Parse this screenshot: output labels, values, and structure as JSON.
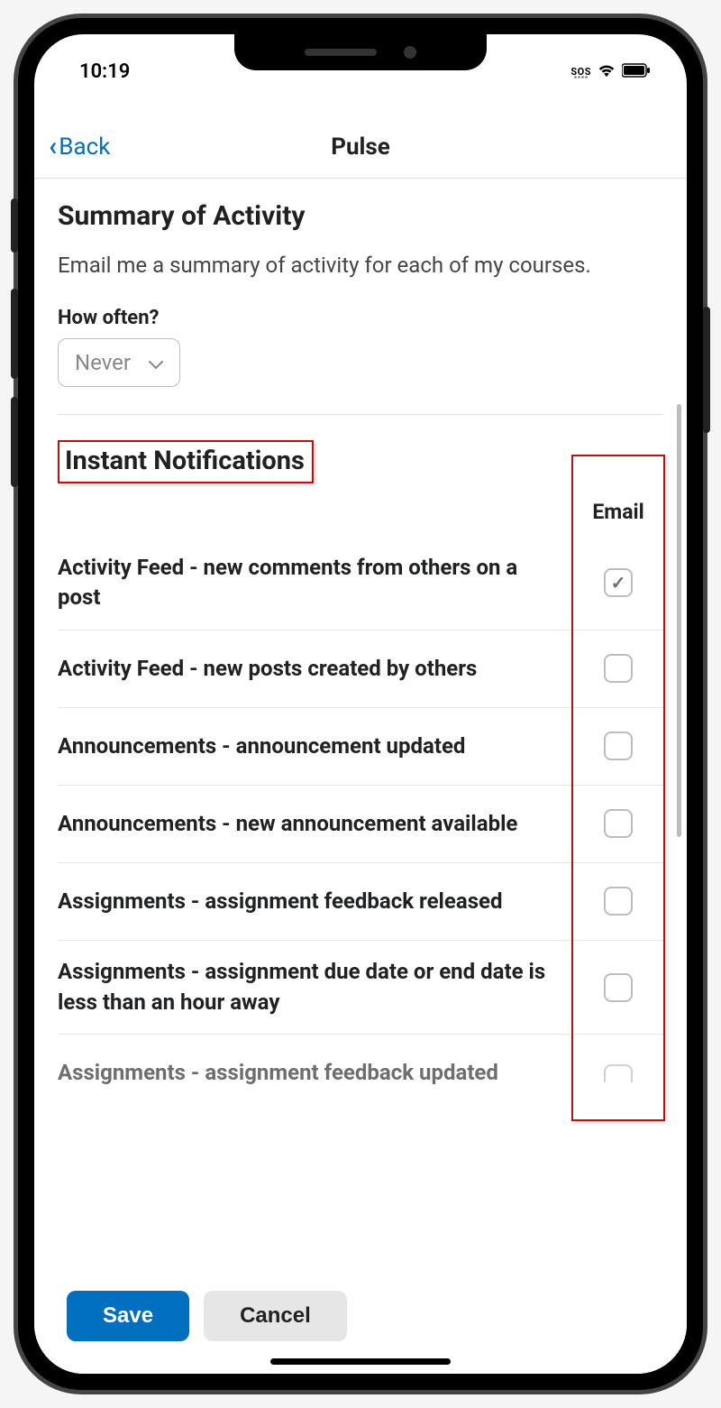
{
  "status": {
    "time": "10:19",
    "sos": "SOS"
  },
  "nav": {
    "back": "Back",
    "title": "Pulse"
  },
  "summary": {
    "title": "Summary of Activity",
    "desc": "Email me a summary of activity for each of my courses.",
    "freq_label": "How often?",
    "freq_value": "Never"
  },
  "instant": {
    "title": "Instant Notifications",
    "email_col": "Email",
    "items": [
      {
        "label": "Activity Feed - new comments from others on a post",
        "checked": true
      },
      {
        "label": "Activity Feed - new posts created by others",
        "checked": false
      },
      {
        "label": "Announcements - announcement updated",
        "checked": false
      },
      {
        "label": "Announcements - new announcement available",
        "checked": false
      },
      {
        "label": "Assignments - assignment feedback released",
        "checked": false
      },
      {
        "label": "Assignments - assignment due date or end date is less than an hour away",
        "checked": false
      },
      {
        "label": "Assignments - assignment feedback updated",
        "checked": false
      }
    ]
  },
  "footer": {
    "save": "Save",
    "cancel": "Cancel"
  }
}
